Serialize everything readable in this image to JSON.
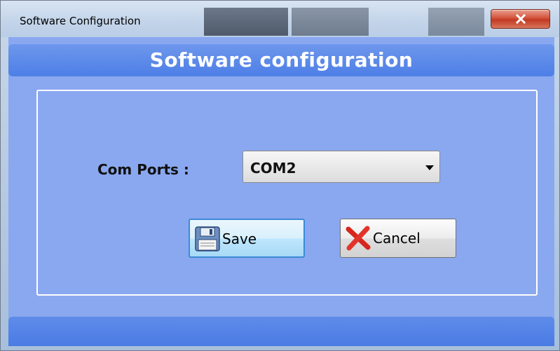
{
  "window": {
    "title": "Software Configuration",
    "close_icon": "close-icon"
  },
  "header": {
    "title": "Software configuration"
  },
  "form": {
    "com_ports_label": "Com Ports :",
    "com_ports_selected": "COM2"
  },
  "buttons": {
    "save_label": "Save",
    "save_icon": "floppy-disk-icon",
    "cancel_label": "Cancel",
    "cancel_icon": "red-x-icon"
  },
  "colors": {
    "client_background": "#8aa8f0",
    "header_band": "#4d7fe6",
    "close_button": "#c23a22"
  }
}
